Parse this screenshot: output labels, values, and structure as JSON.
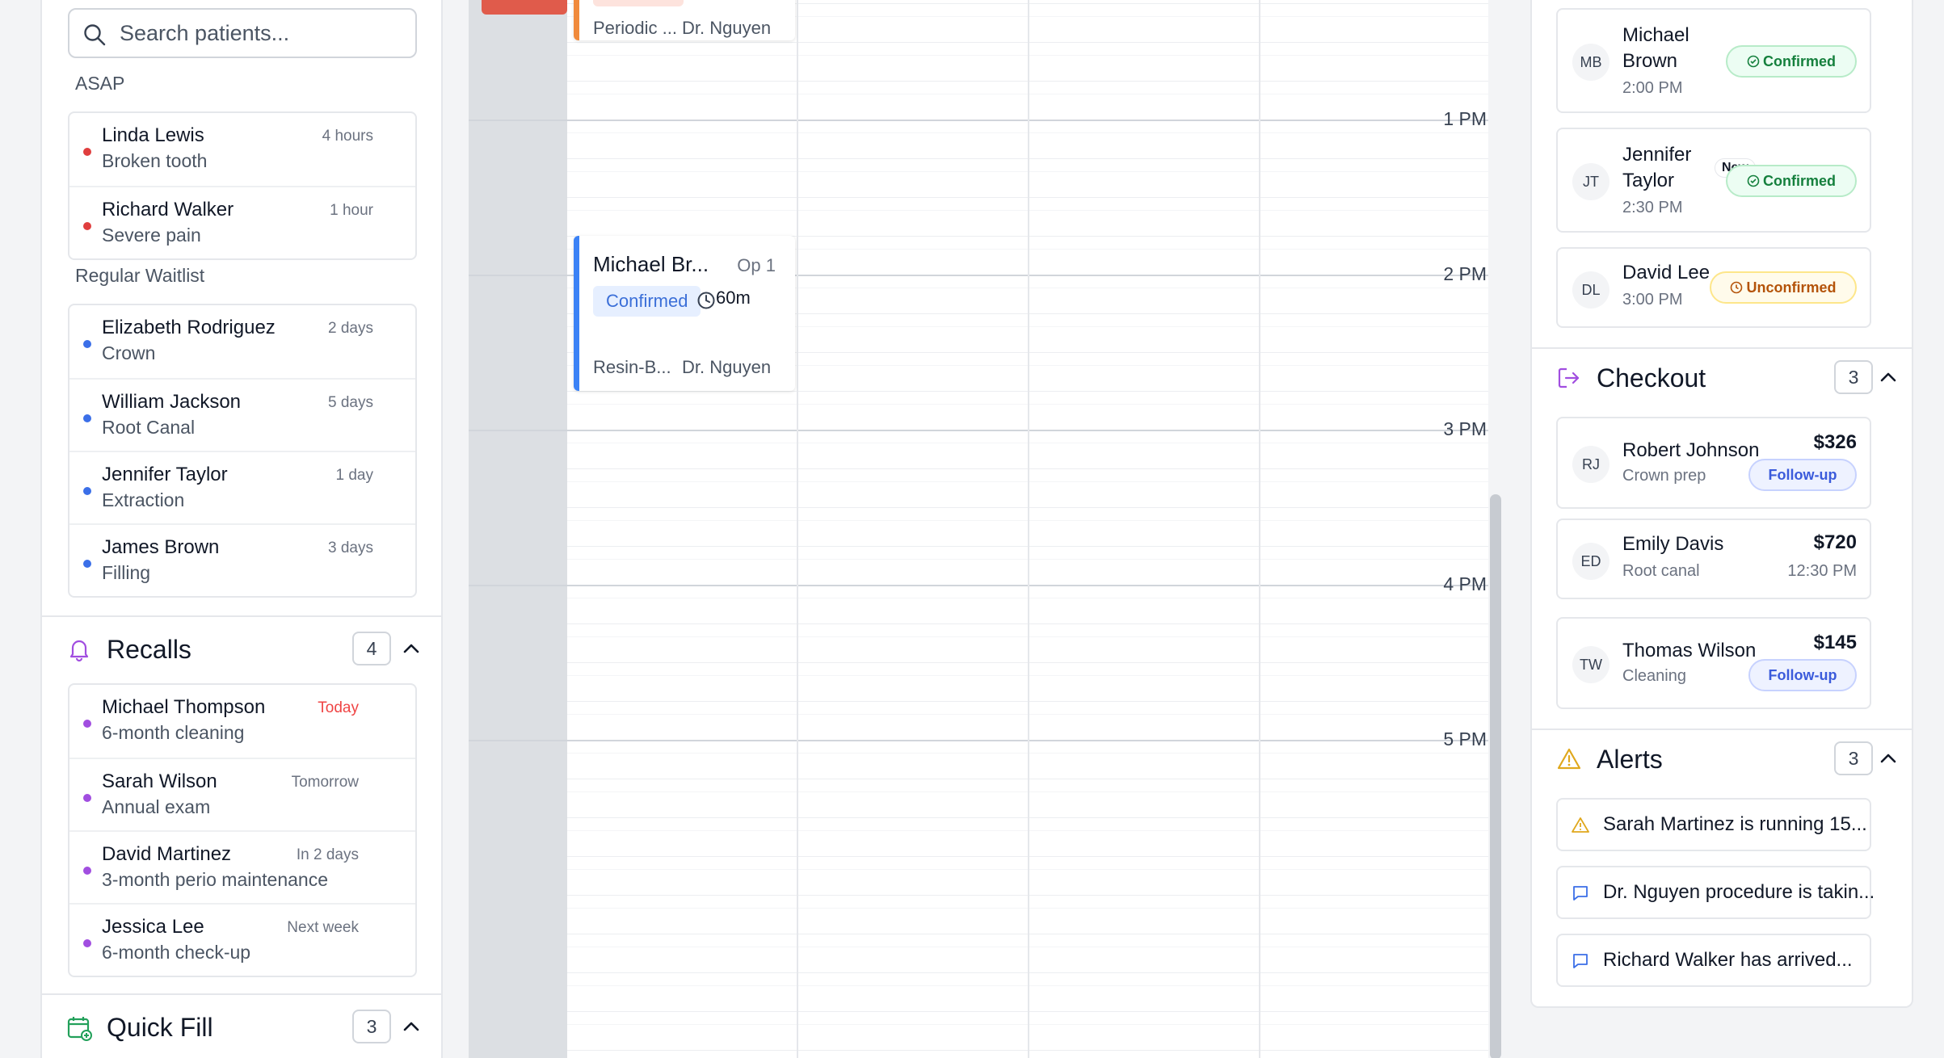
{
  "search": {
    "placeholder": "Search patients..."
  },
  "waitlist": {
    "asap_label": "ASAP",
    "asap": [
      {
        "name": "Linda Lewis",
        "reason": "Broken tooth",
        "time": "4 hours",
        "color": "#e03e3e"
      },
      {
        "name": "Richard Walker",
        "reason": "Severe pain",
        "time": "1 hour",
        "color": "#e03e3e"
      }
    ],
    "regular_label": "Regular Waitlist",
    "regular": [
      {
        "name": "Elizabeth Rodriguez",
        "reason": "Crown",
        "time": "2 days",
        "color": "#3b6fe8"
      },
      {
        "name": "William Jackson",
        "reason": "Root Canal",
        "time": "5 days",
        "color": "#3b6fe8"
      },
      {
        "name": "Jennifer Taylor",
        "reason": "Extraction",
        "time": "1 day",
        "color": "#3b6fe8"
      },
      {
        "name": "James Brown",
        "reason": "Filling",
        "time": "3 days",
        "color": "#3b6fe8"
      }
    ]
  },
  "recalls": {
    "title": "Recalls",
    "count": "4",
    "items": [
      {
        "name": "Michael Thompson",
        "reason": "6-month cleaning",
        "time": "Today",
        "color": "#a14ee0"
      },
      {
        "name": "Sarah Wilson",
        "reason": "Annual exam",
        "time": "Tomorrow",
        "color": "#a14ee0"
      },
      {
        "name": "David Martinez",
        "reason": "3-month perio maintenance",
        "time": "In 2 days",
        "color": "#a14ee0"
      },
      {
        "name": "Jessica Lee",
        "reason": "6-month check-up",
        "time": "Next week",
        "color": "#a14ee0"
      }
    ]
  },
  "quick_fill": {
    "title": "Quick Fill",
    "count": "3"
  },
  "calendar": {
    "hours": [
      "1 PM",
      "2 PM",
      "3 PM",
      "4 PM",
      "5 PM"
    ],
    "prev_appt": {
      "procedure": "Periodic ...",
      "doctor": "Dr. Nguyen",
      "color": "#f08a3c"
    },
    "appt": {
      "name": "Michael Br...",
      "op": "Op 1",
      "status": "Confirmed",
      "duration": "60m",
      "procedure": "Resin-B...",
      "doctor": "Dr. Nguyen",
      "color": "#3b82f6"
    }
  },
  "arrivals": [
    {
      "initials": "MB",
      "name_line1": "Michael",
      "name_line2": "Brown",
      "time": "2:00 PM",
      "status": "Confirmed"
    },
    {
      "initials": "JT",
      "name_line1": "Jennifer",
      "name_line2": "Taylor",
      "time": "2:30 PM",
      "status": "Confirmed",
      "tag": "New"
    },
    {
      "initials": "DL",
      "name_line1": "David Lee",
      "time": "3:00 PM",
      "status": "Unconfirmed"
    }
  ],
  "checkout": {
    "title": "Checkout",
    "count": "3",
    "items": [
      {
        "initials": "RJ",
        "name": "Robert Johnson",
        "detail": "Crown prep",
        "amount": "$326",
        "action": "Follow-up"
      },
      {
        "initials": "ED",
        "name": "Emily Davis",
        "detail": "Root canal",
        "amount": "$720",
        "time": "12:30 PM"
      },
      {
        "initials": "TW",
        "name": "Thomas Wilson",
        "detail": "Cleaning",
        "amount": "$145",
        "action": "Follow-up"
      }
    ]
  },
  "alerts": {
    "title": "Alerts",
    "count": "3",
    "items": [
      {
        "icon": "warning-icon",
        "text": "Sarah Martinez is running 15..."
      },
      {
        "icon": "message-icon",
        "text": "Dr. Nguyen procedure is takin..."
      },
      {
        "icon": "message-icon",
        "text": "Richard Walker has arrived..."
      }
    ]
  }
}
